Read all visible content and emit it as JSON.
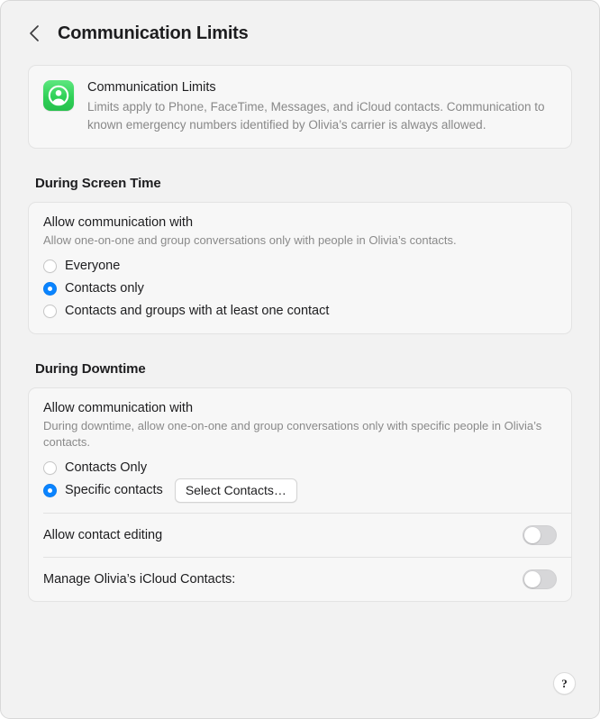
{
  "header": {
    "back_icon": "chevron-left-icon",
    "title": "Communication Limits"
  },
  "info_card": {
    "icon": "communication-limits-app-icon",
    "title": "Communication Limits",
    "description": "Limits apply to Phone, FaceTime, Messages, and iCloud contacts. Communication to known emergency numbers identified by Olivia’s carrier is always allowed."
  },
  "screen_time": {
    "section_title": "During Screen Time",
    "group_label": "Allow communication with",
    "group_desc": "Allow one-on-one and group conversations only with people in Olivia’s contacts.",
    "options": [
      {
        "label": "Everyone",
        "selected": false
      },
      {
        "label": "Contacts only",
        "selected": true
      },
      {
        "label": "Contacts and groups with at least one contact",
        "selected": false
      }
    ]
  },
  "downtime": {
    "section_title": "During Downtime",
    "group_label": "Allow communication with",
    "group_desc": "During downtime, allow one-on-one and group conversations only with specific people in Olivia’s contacts.",
    "options": [
      {
        "label": "Contacts Only",
        "selected": false
      },
      {
        "label": "Specific contacts",
        "selected": true
      }
    ],
    "select_contacts_button": "Select Contacts…",
    "toggles": [
      {
        "label": "Allow contact editing",
        "on": false
      },
      {
        "label": "Manage Olivia’s iCloud Contacts:",
        "on": false
      }
    ]
  },
  "help": {
    "icon": "question-mark-icon",
    "label": "?"
  },
  "colors": {
    "accent_blue": "#0a84ff",
    "icon_green": "#30d158",
    "window_bg": "#f2f2f2",
    "card_bg": "#f7f7f7"
  }
}
